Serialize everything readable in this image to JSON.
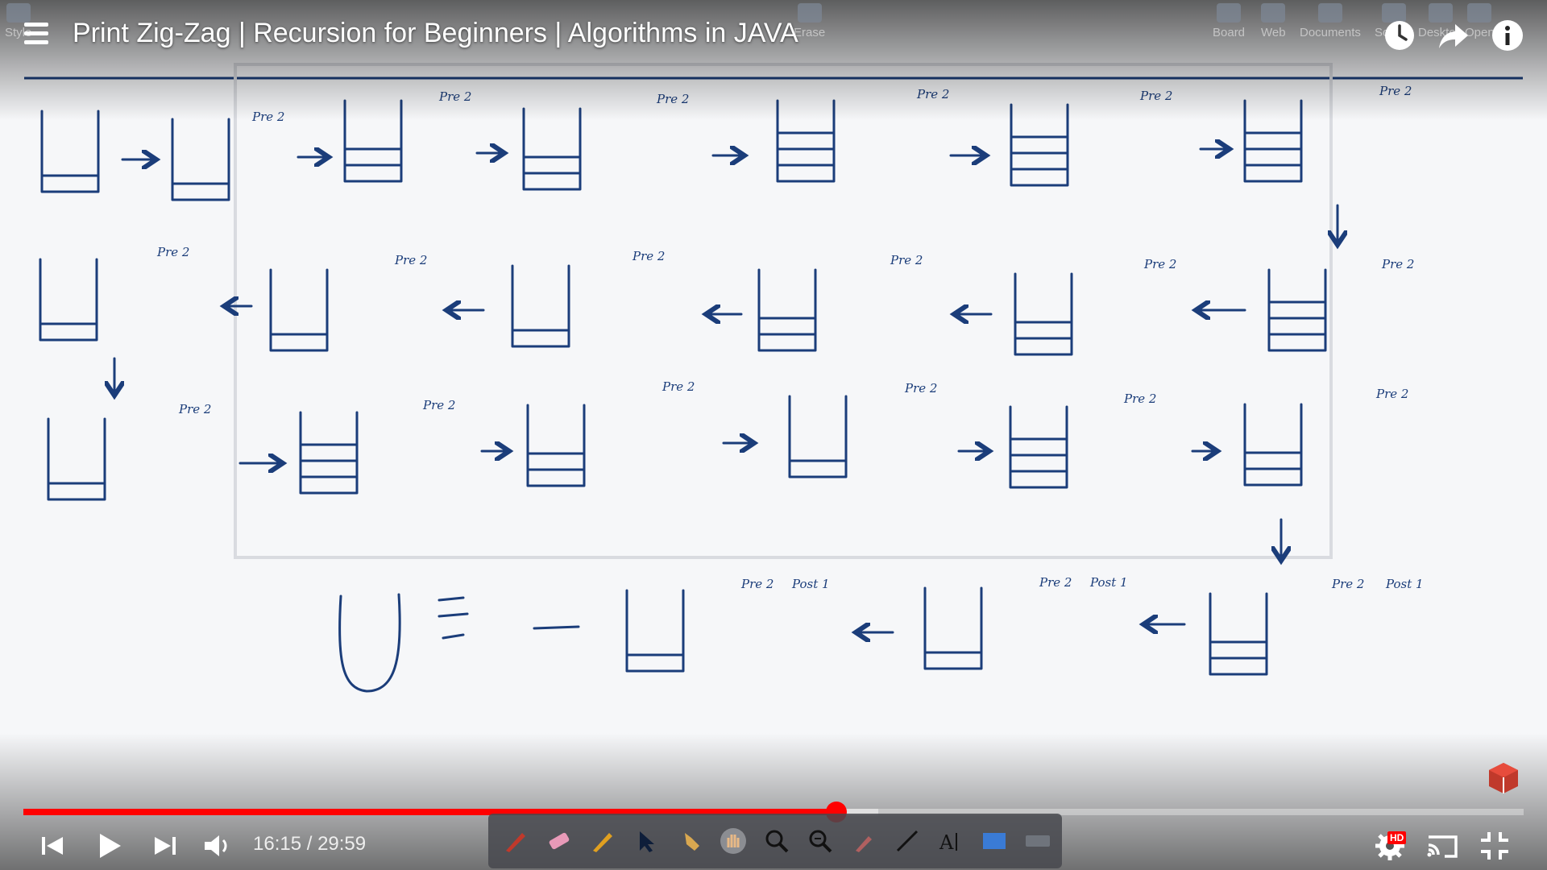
{
  "video": {
    "title": "Print Zig-Zag | Recursion for Beginners | Algorithms in JAVA",
    "current_time": "16:15",
    "duration": "29:59",
    "time_text": "16:15 / 29:59",
    "progress_fraction": 0.542,
    "buffer_fraction": 0.57,
    "quality_badge": "HD"
  },
  "app_toolbar": {
    "items": [
      {
        "label": "Style"
      },
      {
        "label": "Erase"
      },
      {
        "label": "Board"
      },
      {
        "label": "Web"
      },
      {
        "label": "Documents"
      },
      {
        "label": "Screen"
      },
      {
        "label": "Desktop"
      },
      {
        "label": "Open"
      }
    ]
  },
  "icons": {
    "menu": "playlist-icon",
    "watch_later": "clock-icon",
    "share": "share-icon",
    "info": "info-icon",
    "prev": "previous-icon",
    "play": "play-icon",
    "next": "next-icon",
    "volume": "volume-icon",
    "settings": "gear-icon",
    "cast": "cast-icon",
    "exit_fullscreen": "exit-fullscreen-icon"
  },
  "colors": {
    "accent": "#ff0000",
    "ink": "#1b3d7a"
  }
}
